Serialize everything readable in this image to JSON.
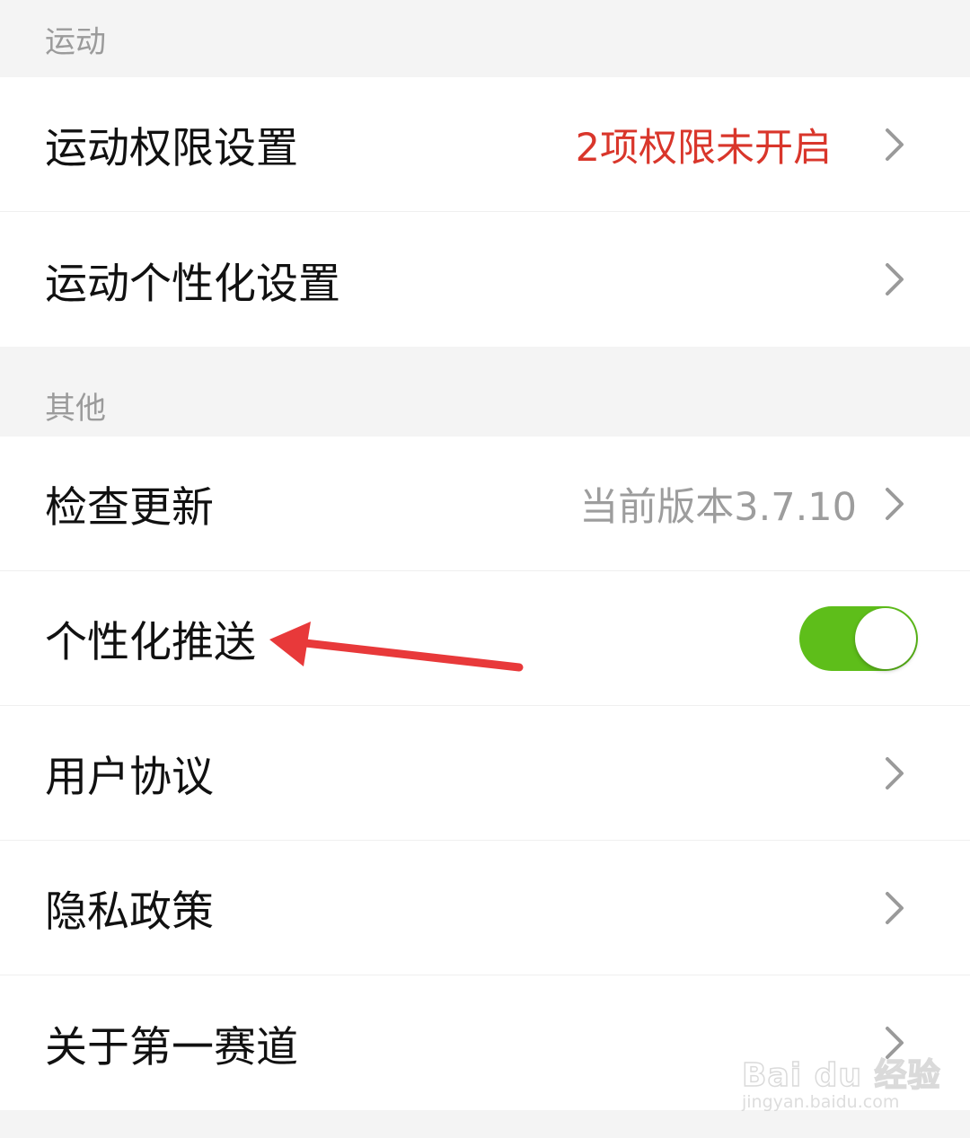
{
  "sections": [
    {
      "header": "运动",
      "rows": [
        {
          "label": "运动权限设置",
          "value": "2项权限未开启",
          "chevron": "chevron-right-icon"
        },
        {
          "label": "运动个性化设置",
          "chevron": "chevron-right-icon"
        }
      ]
    },
    {
      "header": "其他",
      "rows": [
        {
          "label": "检查更新",
          "value": "当前版本3.7.10",
          "chevron": "chevron-right-icon"
        },
        {
          "label": "个性化推送",
          "toggle": {
            "on": true,
            "color": "#5ebe1a"
          }
        },
        {
          "label": "用户协议",
          "chevron": "chevron-right-icon"
        },
        {
          "label": "隐私政策",
          "chevron": "chevron-right-icon"
        },
        {
          "label": "关于第一赛道",
          "chevron": "chevron-right-icon"
        }
      ]
    }
  ],
  "annotation": {
    "type": "arrow",
    "color": "#e8393a",
    "points_to": "个性化推送"
  },
  "watermark": {
    "brand": "Bai du 经验",
    "url": "jingyan.baidu.com"
  },
  "colors": {
    "warning_text": "#d9362b",
    "muted_text": "#9d9d9d",
    "section_header_text": "#9b9b9b",
    "background": "#f4f4f4",
    "toggle_on": "#5ebe1a"
  }
}
